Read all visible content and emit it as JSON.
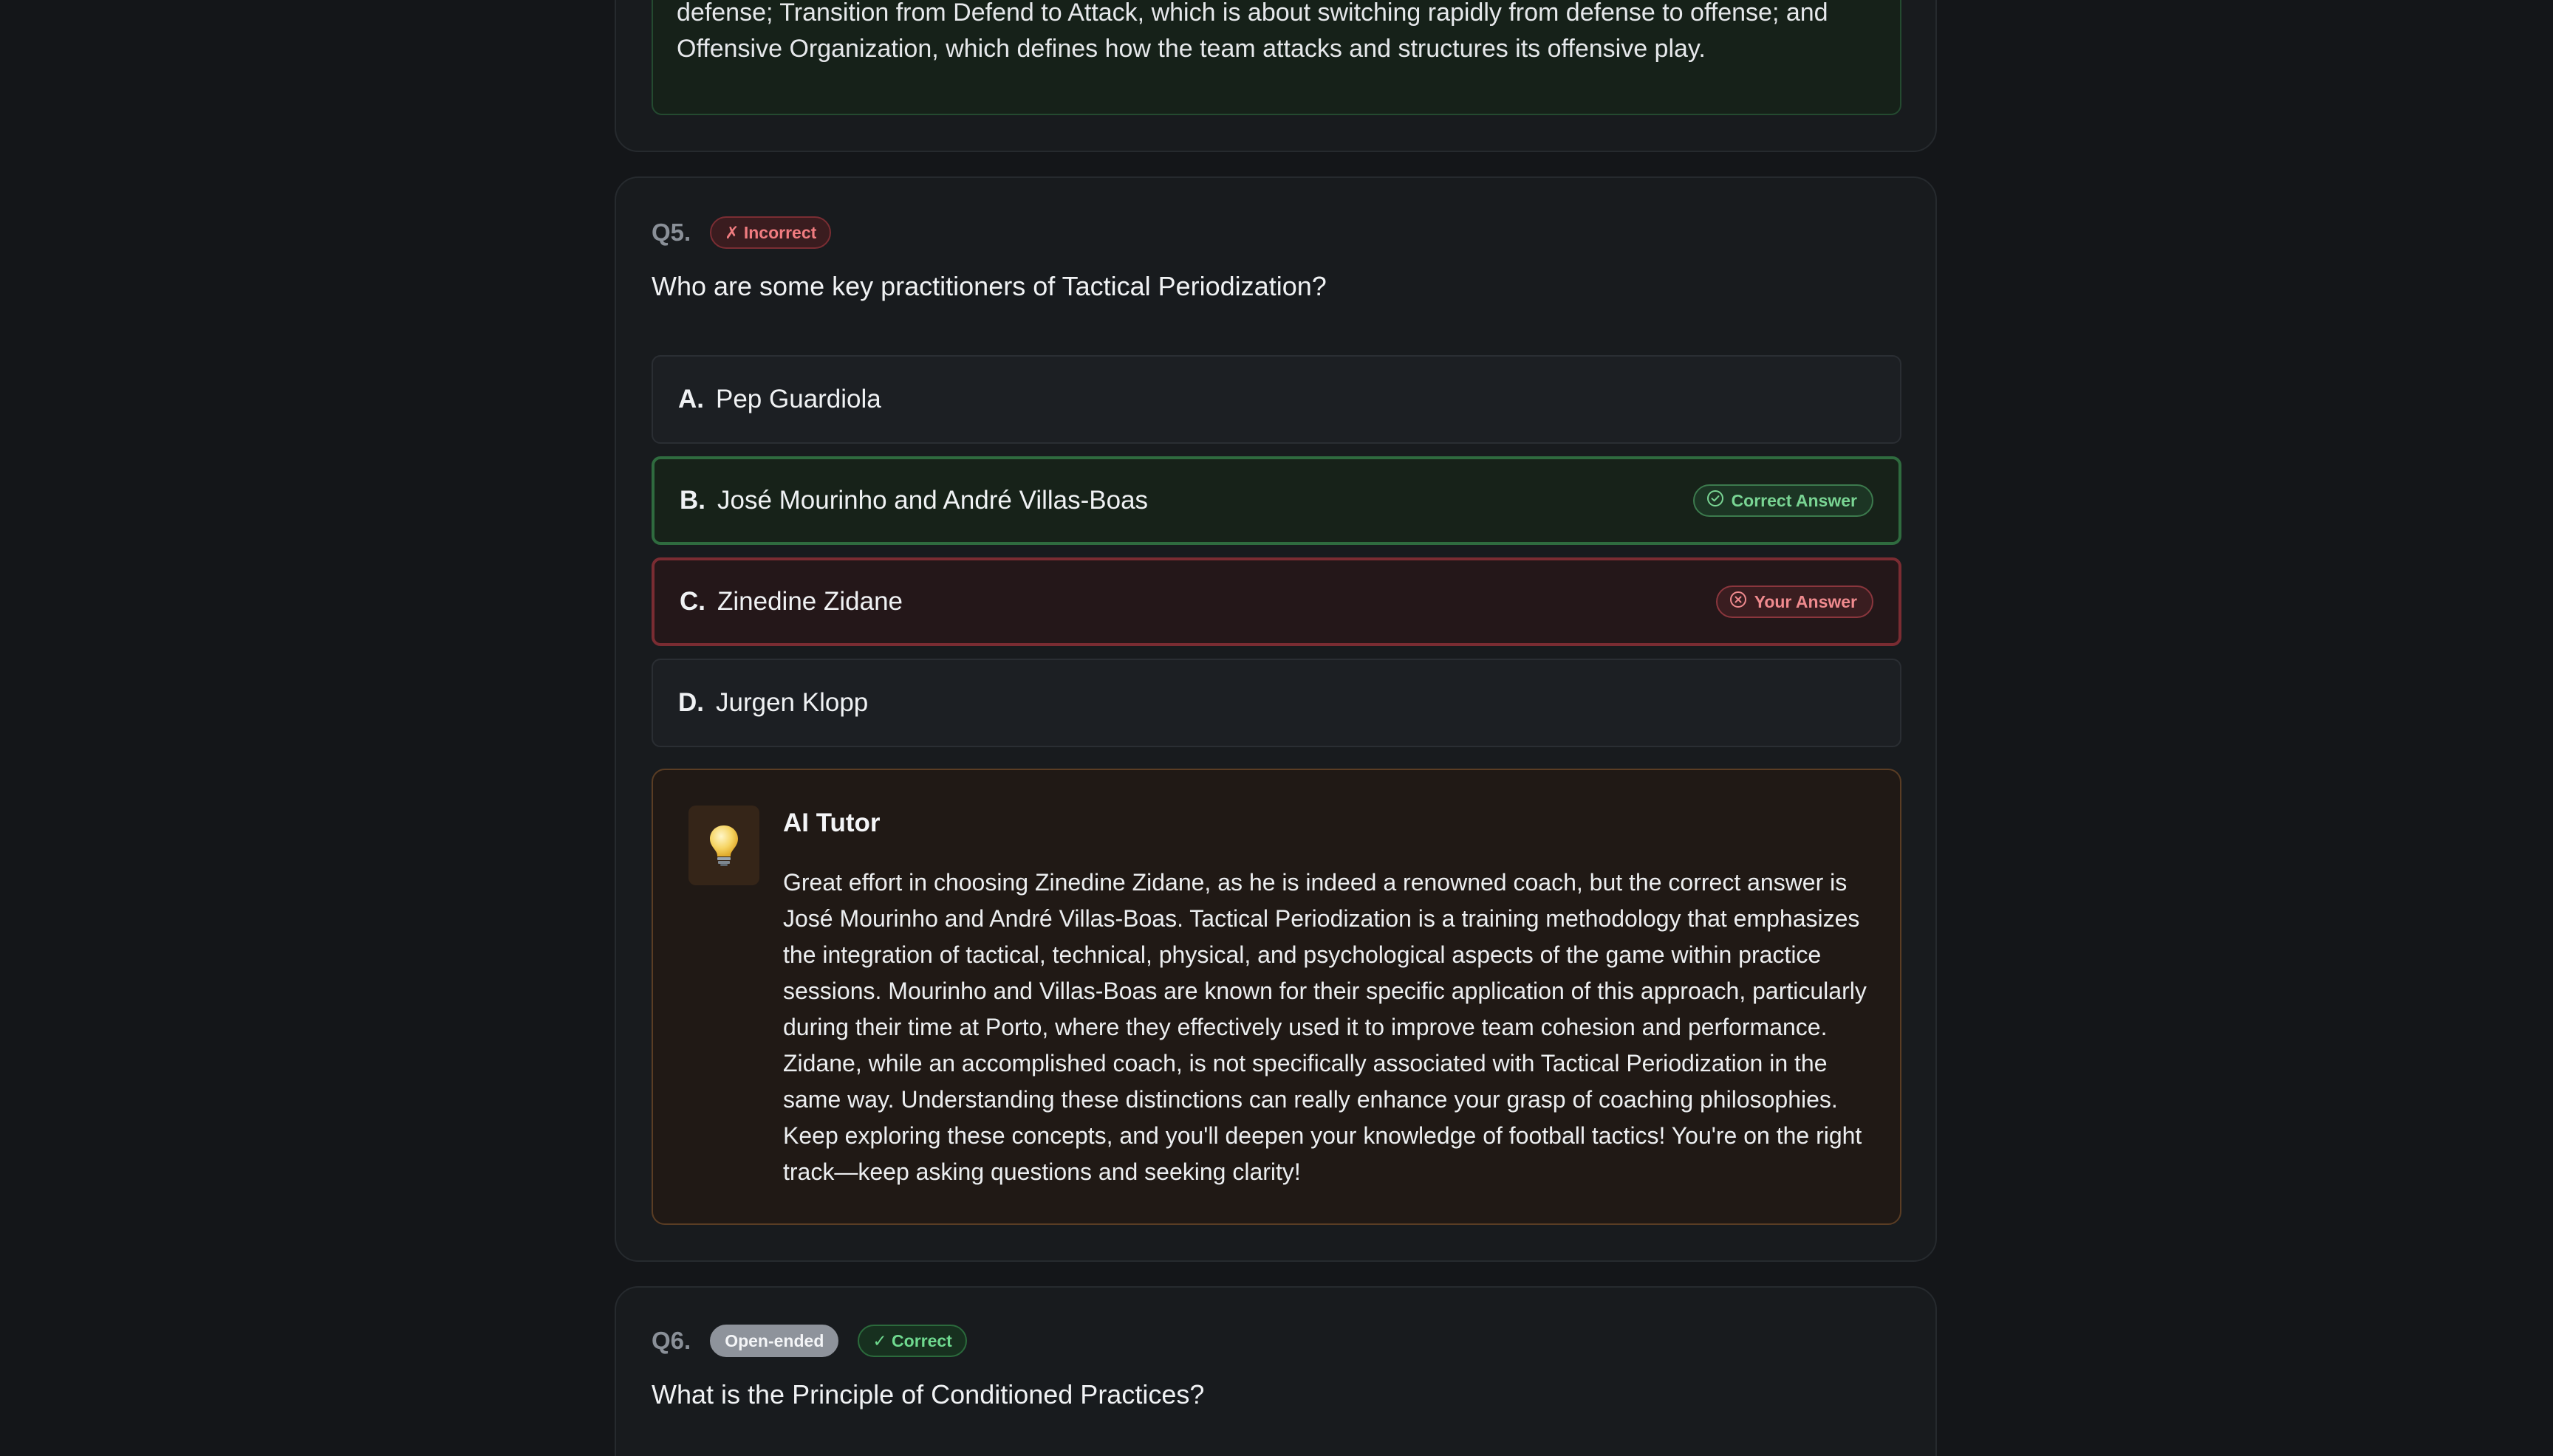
{
  "previous": {
    "answer_text": "defends collectively; Transition from Attack to Defend, which is about quickly changing from offense to defense; Transition from Defend to Attack, which is about switching rapidly from defense to offense; and Offensive Organization, which defines how the team attacks and structures its offensive play."
  },
  "q5": {
    "number": "Q5.",
    "status_badge": "✗ Incorrect",
    "question": "Who are some key practitioners of Tactical Periodization?",
    "options": [
      {
        "letter": "A.",
        "text": "Pep Guardiola"
      },
      {
        "letter": "B.",
        "text": "José Mourinho and André Villas-Boas",
        "badge": "Correct Answer"
      },
      {
        "letter": "C.",
        "text": "Zinedine Zidane",
        "badge": "Your Answer"
      },
      {
        "letter": "D.",
        "text": "Jurgen Klopp"
      }
    ],
    "tutor": {
      "icon": "lightbulb-icon",
      "title": "AI Tutor",
      "body": "Great effort in choosing Zinedine Zidane, as he is indeed a renowned coach, but the correct answer is José Mourinho and André Villas-Boas. Tactical Periodization is a training methodology that emphasizes the integration of tactical, technical, physical, and psychological aspects of the game within practice sessions. Mourinho and Villas-Boas are known for their specific application of this approach, particularly during their time at Porto, where they effectively used it to improve team cohesion and performance. Zidane, while an accomplished coach, is not specifically associated with Tactical Periodization in the same way. Understanding these distinctions can really enhance your grasp of coaching philosophies. Keep exploring these concepts, and you'll deepen your knowledge of football tactics! You're on the right track—keep asking questions and seeking clarity!"
    }
  },
  "q6": {
    "number": "Q6.",
    "type_badge": "Open-ended",
    "status_badge": "✓ Correct",
    "question": "What is the Principle of Conditioned Practices?"
  },
  "colors": {
    "background": "#141619",
    "card": "#181b1e",
    "correct": "#2f6b3f",
    "incorrect": "#7a2c32",
    "tutor_border": "#5a3d24"
  }
}
